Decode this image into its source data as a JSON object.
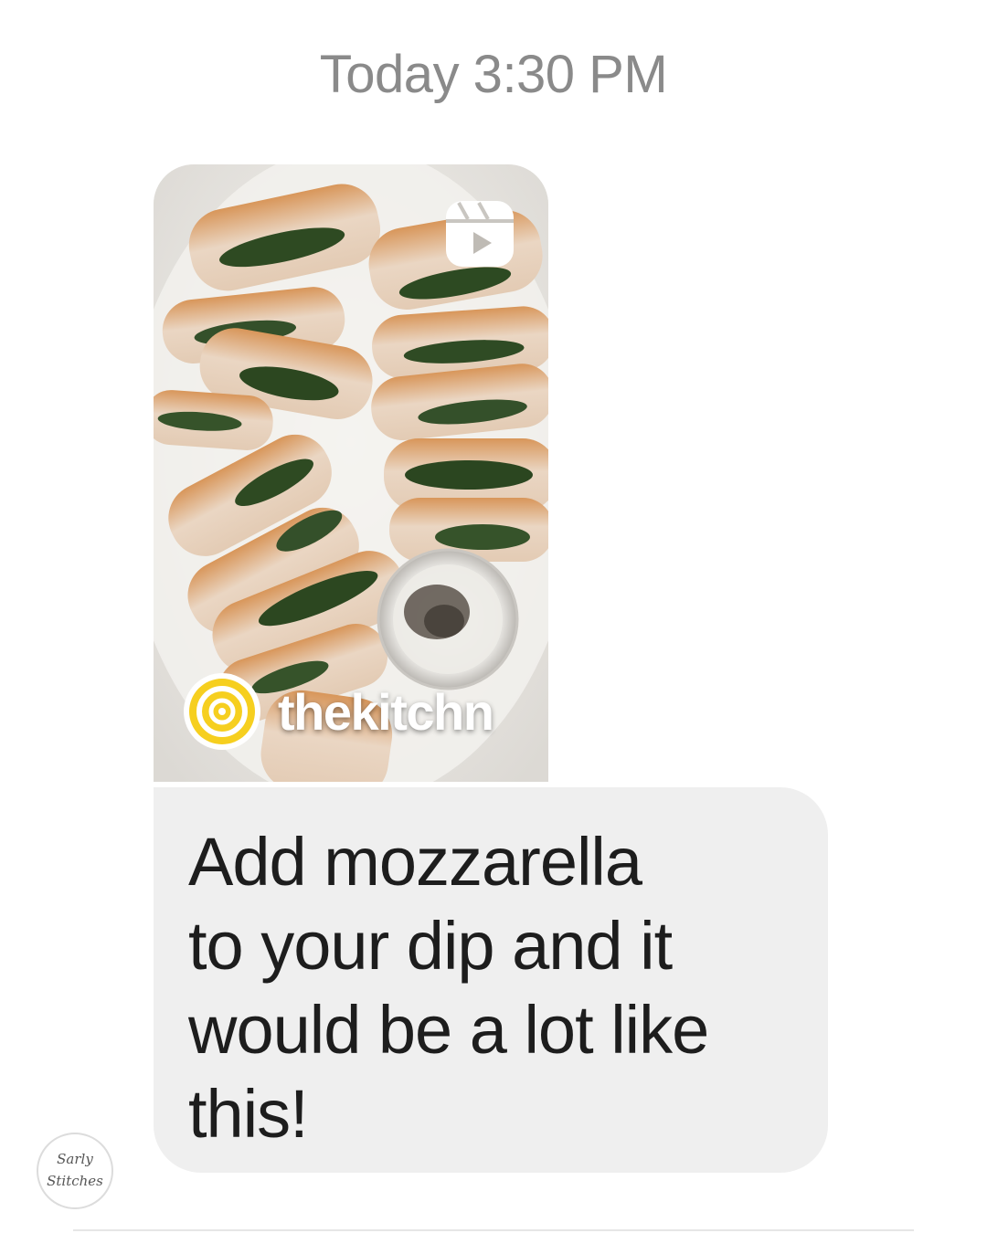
{
  "thread": {
    "timestamp": "Today 3:30 PM"
  },
  "shared_reel": {
    "source_name": "thekitchn",
    "icon": "reels-icon",
    "source_logo_icon": "kitchn-logo-icon"
  },
  "message": {
    "text": "Add mozzarella\nto your dip and it\nwould be a lot like\nthis!"
  },
  "avatar": {
    "line1": "Sarly",
    "line2": "Stitches"
  },
  "colors": {
    "bubble": "#efefef",
    "timestamp": "#8a8a8a",
    "logo_yellow": "#f6cf1f"
  }
}
